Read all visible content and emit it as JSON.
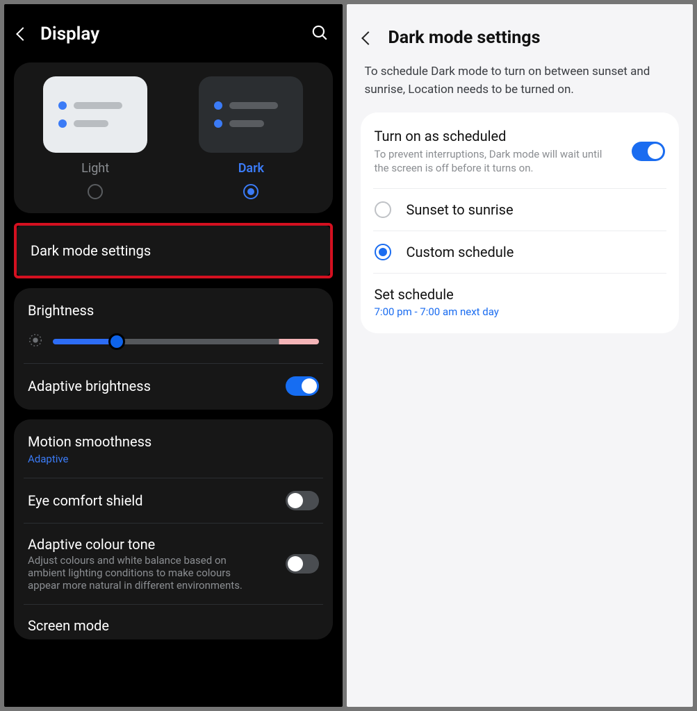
{
  "left": {
    "title": "Display",
    "theme": {
      "light_label": "Light",
      "dark_label": "Dark",
      "selected": "dark"
    },
    "dark_mode_settings_label": "Dark mode settings",
    "brightness": {
      "title": "Brightness",
      "value_percent": 24
    },
    "adaptive_brightness": {
      "title": "Adaptive brightness",
      "enabled": true
    },
    "motion_smoothness": {
      "title": "Motion smoothness",
      "value": "Adaptive"
    },
    "eye_comfort": {
      "title": "Eye comfort shield",
      "enabled": false
    },
    "adaptive_colour": {
      "title": "Adaptive colour tone",
      "desc": "Adjust colours and white balance based on ambient lighting conditions to make colours appear more natural in different environments.",
      "enabled": false
    },
    "screen_mode": {
      "title": "Screen mode"
    }
  },
  "right": {
    "title": "Dark mode settings",
    "desc": "To schedule Dark mode to turn on between sunset and sunrise, Location needs to be turned on.",
    "scheduled": {
      "title": "Turn on as scheduled",
      "desc": "To prevent interruptions, Dark mode will wait until the screen is off before it turns on.",
      "enabled": true
    },
    "options": {
      "sunset": "Sunset to sunrise",
      "custom": "Custom schedule",
      "selected": "custom"
    },
    "set_schedule": {
      "title": "Set schedule",
      "value": "7:00 pm - 7:00 am next day"
    }
  }
}
